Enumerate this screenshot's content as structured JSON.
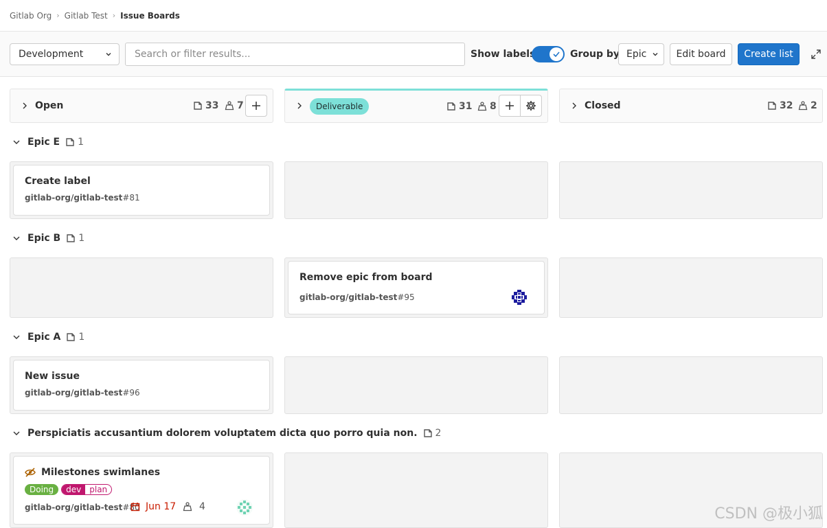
{
  "breadcrumb": [
    "Gitlab Org",
    "Gitlab Test",
    "Issue Boards"
  ],
  "toolbar": {
    "board_name": "Development",
    "search_placeholder": "Search or filter results...",
    "show_labels": "Show labels",
    "show_labels_on": true,
    "group_by_label": "Group by",
    "group_by_value": "Epic",
    "edit_board": "Edit board",
    "create_list": "Create list"
  },
  "lists": [
    {
      "title": "Open",
      "issues": "33",
      "weight": "7"
    },
    {
      "title": "Deliverable",
      "issues": "31",
      "weight": "8",
      "color": "#7de0d8"
    },
    {
      "title": "Closed",
      "issues": "32",
      "weight": "2"
    }
  ],
  "epics": [
    {
      "title": "Epic E",
      "count": "1"
    },
    {
      "title": "Epic B",
      "count": "1"
    },
    {
      "title": "Epic A",
      "count": "1"
    },
    {
      "title": "Perspiciatis accusantium dolorem voluptatem dicta quo porro quia non.",
      "count": "2"
    }
  ],
  "cards": [
    {
      "title": "Create label",
      "ref_path": "gitlab-org/gitlab-test",
      "ref_num": "#81"
    },
    {
      "title": "Remove epic from board",
      "ref_path": "gitlab-org/gitlab-test",
      "ref_num": "#95"
    },
    {
      "title": "New issue",
      "ref_path": "gitlab-org/gitlab-test",
      "ref_num": "#96"
    },
    {
      "title": "Milestones swimlanes",
      "ref_path": "gitlab-org/gitlab-test",
      "ref_num": "#80",
      "labels": [
        {
          "text": "Doing",
          "color": "#69b042"
        },
        {
          "scope": "dev",
          "value": "plan",
          "color": "#c0176e"
        }
      ],
      "due": "Jun 17",
      "weight": "4"
    }
  ],
  "watermark": "CSDN @极小狐"
}
